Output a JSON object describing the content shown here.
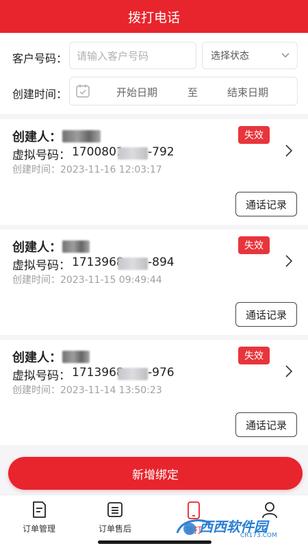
{
  "header": {
    "title": "拨打电话"
  },
  "filters": {
    "customer_label": "客户号码：",
    "customer_placeholder": "请输入客户号码",
    "status_placeholder": "选择状态",
    "time_label": "创建时间：",
    "start_date": "开始日期",
    "separator": "至",
    "end_date": "结束日期"
  },
  "cards": [
    {
      "creator_label": "创建人：",
      "phone_label": "虚拟号码：",
      "phone_prefix": "1700801",
      "phone_suffix": "-792",
      "time": "创建时间：2023-11-16 12:03:17",
      "status": "失效",
      "action": "通话记录"
    },
    {
      "creator_label": "创建人：",
      "phone_label": "虚拟号码：",
      "phone_prefix": "1713968",
      "phone_suffix": "-894",
      "time": "创建时间：2023-11-15 09:49:44",
      "status": "失效",
      "action": "通话记录"
    },
    {
      "creator_label": "创建人：",
      "phone_label": "虚拟号码：",
      "phone_prefix": "1713968",
      "phone_suffix": "-976",
      "time": "创建时间：2023-11-14 13:50:23",
      "status": "失效",
      "action": "通话记录"
    }
  ],
  "add_button": "新增绑定",
  "tabs": [
    {
      "label": "订单管理",
      "icon": "order-doc-icon"
    },
    {
      "label": "订单售后",
      "icon": "after-sale-icon"
    },
    {
      "label": "拨打",
      "icon": "phone-icon"
    },
    {
      "label": "",
      "icon": "user-icon"
    }
  ],
  "watermark": {
    "text": "西西软件园",
    "url": "CR173.COM"
  },
  "colors": {
    "brand": "#e8242c",
    "badge": "#e8353c"
  }
}
